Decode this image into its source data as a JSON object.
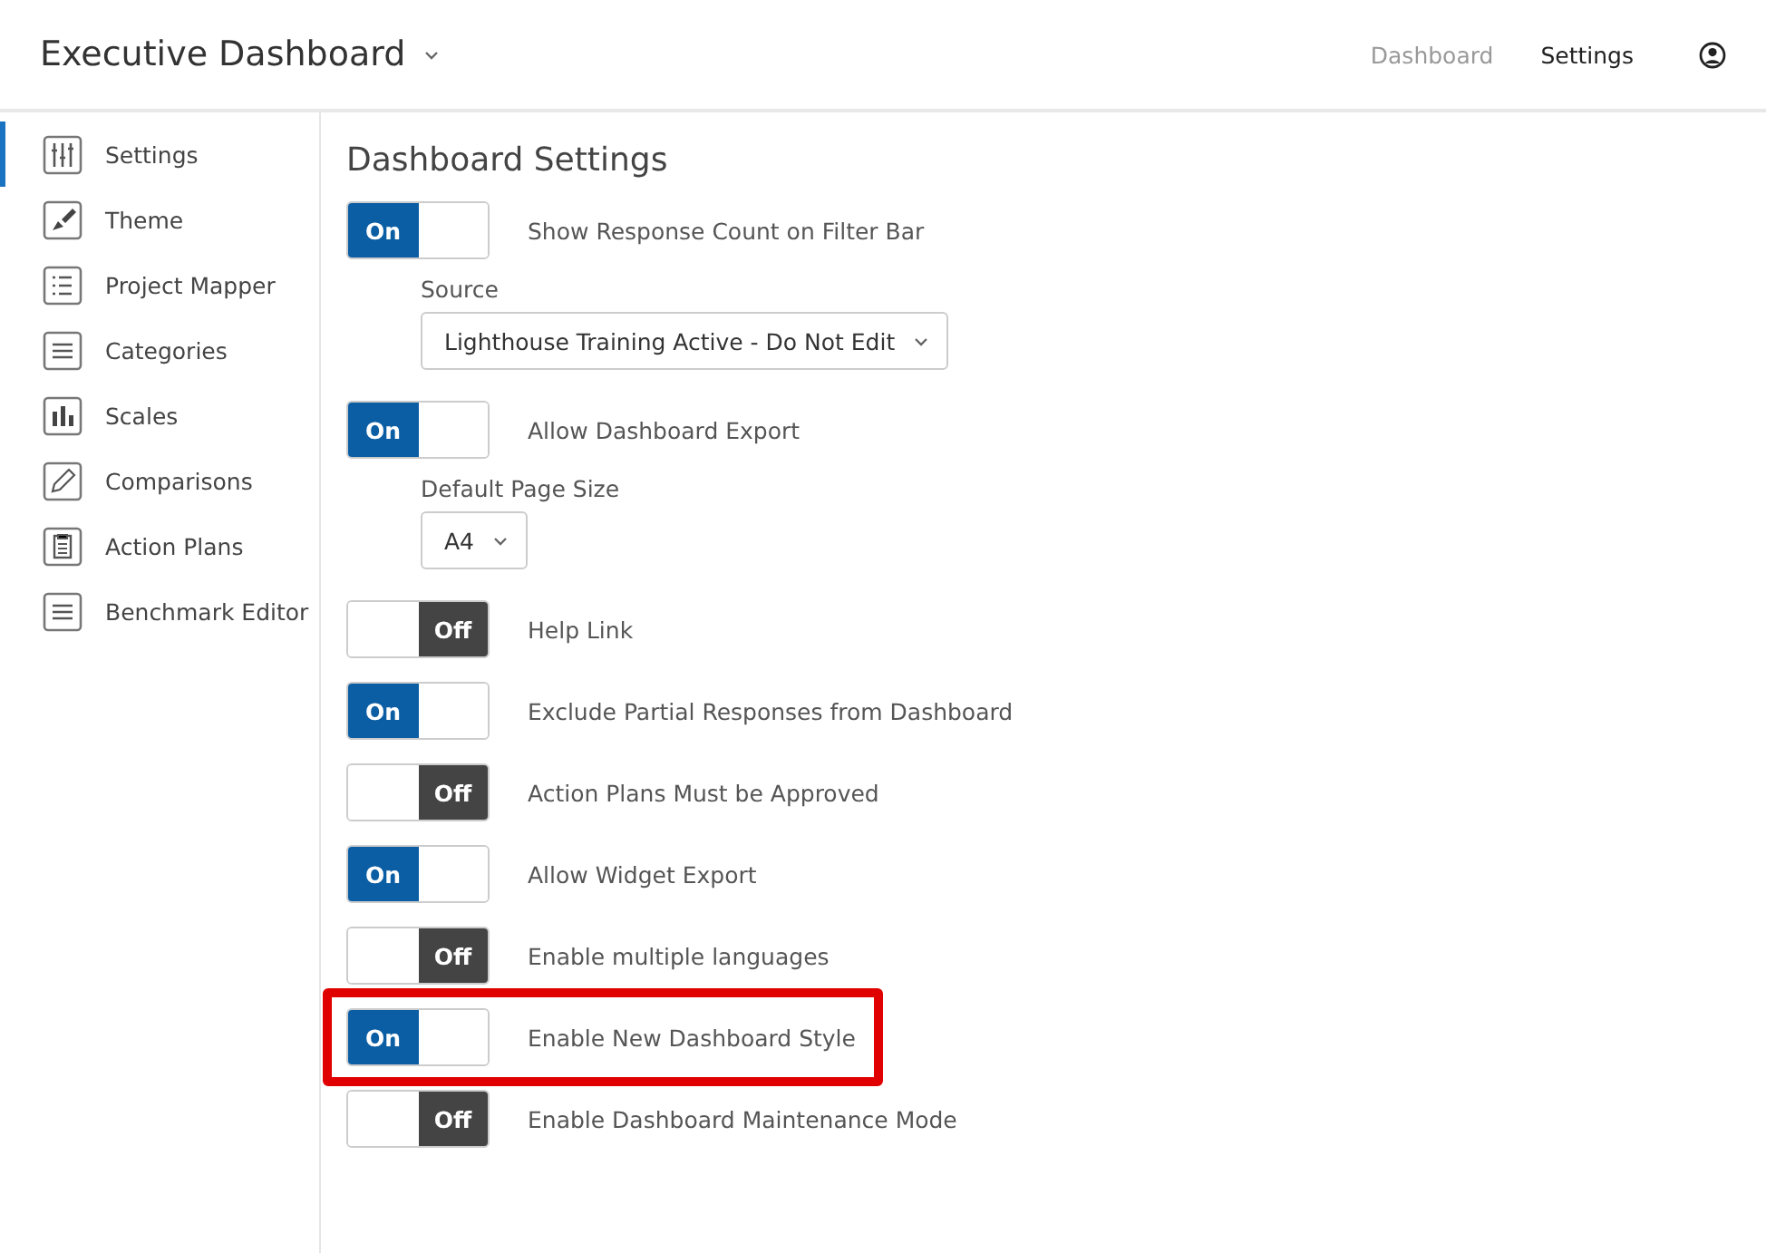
{
  "header": {
    "title": "Executive Dashboard",
    "nav": [
      {
        "label": "Dashboard",
        "selected": false
      },
      {
        "label": "Settings",
        "selected": true
      }
    ]
  },
  "sidebar": {
    "items": [
      {
        "label": "Settings",
        "selected": true
      },
      {
        "label": "Theme",
        "selected": false
      },
      {
        "label": "Project Mapper",
        "selected": false
      },
      {
        "label": "Categories",
        "selected": false
      },
      {
        "label": "Scales",
        "selected": false
      },
      {
        "label": "Comparisons",
        "selected": false
      },
      {
        "label": "Action Plans",
        "selected": false
      },
      {
        "label": "Benchmark Editor",
        "selected": false
      }
    ]
  },
  "content": {
    "title": "Dashboard Settings",
    "rows": [
      {
        "kind": "toggle",
        "on": true,
        "state_label": "On",
        "label": "Show Response Count on Filter Bar",
        "highlighted": false
      },
      {
        "kind": "select",
        "label": "Source",
        "value": "Lighthouse Training Active - Do Not Edit"
      },
      {
        "kind": "toggle",
        "on": true,
        "state_label": "On",
        "label": "Allow Dashboard Export",
        "highlighted": false
      },
      {
        "kind": "select",
        "label": "Default Page Size",
        "value": "A4"
      },
      {
        "kind": "toggle",
        "on": false,
        "state_label": "Off",
        "label": "Help Link",
        "highlighted": false
      },
      {
        "kind": "toggle",
        "on": true,
        "state_label": "On",
        "label": "Exclude Partial Responses from Dashboard",
        "highlighted": false
      },
      {
        "kind": "toggle",
        "on": false,
        "state_label": "Off",
        "label": "Action Plans Must be Approved",
        "highlighted": false
      },
      {
        "kind": "toggle",
        "on": true,
        "state_label": "On",
        "label": "Allow Widget Export",
        "highlighted": false
      },
      {
        "kind": "toggle",
        "on": false,
        "state_label": "Off",
        "label": "Enable multiple languages",
        "highlighted": false
      },
      {
        "kind": "toggle",
        "on": true,
        "state_label": "On",
        "label": "Enable New Dashboard Style",
        "highlighted": true
      },
      {
        "kind": "toggle",
        "on": false,
        "state_label": "Off",
        "label": "Enable Dashboard Maintenance Mode",
        "highlighted": false
      }
    ]
  }
}
